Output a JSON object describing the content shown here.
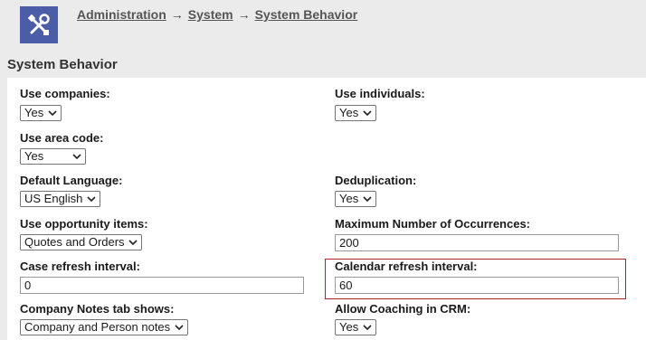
{
  "breadcrumb": {
    "items": [
      "Administration",
      "System",
      "System Behavior"
    ],
    "separator": "→"
  },
  "page": {
    "section_title": "System Behavior"
  },
  "fields": {
    "use_companies": {
      "label": "Use companies:",
      "value": "Yes"
    },
    "use_individuals": {
      "label": "Use individuals:",
      "value": "Yes"
    },
    "use_area_code": {
      "label": "Use area code:",
      "value": "Yes"
    },
    "default_language": {
      "label": "Default Language:",
      "value": "US English"
    },
    "deduplication": {
      "label": "Deduplication:",
      "value": "Yes"
    },
    "use_opportunity_items": {
      "label": "Use opportunity items:",
      "value": "Quotes and Orders"
    },
    "max_occurrences": {
      "label": "Maximum Number of Occurrences:",
      "value": "200"
    },
    "case_refresh_interval": {
      "label": "Case refresh interval:",
      "value": "0"
    },
    "calendar_refresh_interval": {
      "label": "Calendar refresh interval:",
      "value": "60"
    },
    "company_notes_tab": {
      "label": "Company Notes tab shows:",
      "value": "Company and Person notes"
    },
    "allow_coaching": {
      "label": "Allow Coaching in CRM:",
      "value": "Yes"
    }
  },
  "colors": {
    "logo_bg": "#4c5da8",
    "highlight_border": "#b3212f",
    "page_bg": "#ebebeb"
  },
  "icons": {
    "logo": "tools-icon",
    "dropdown": "chevron-down-icon"
  }
}
